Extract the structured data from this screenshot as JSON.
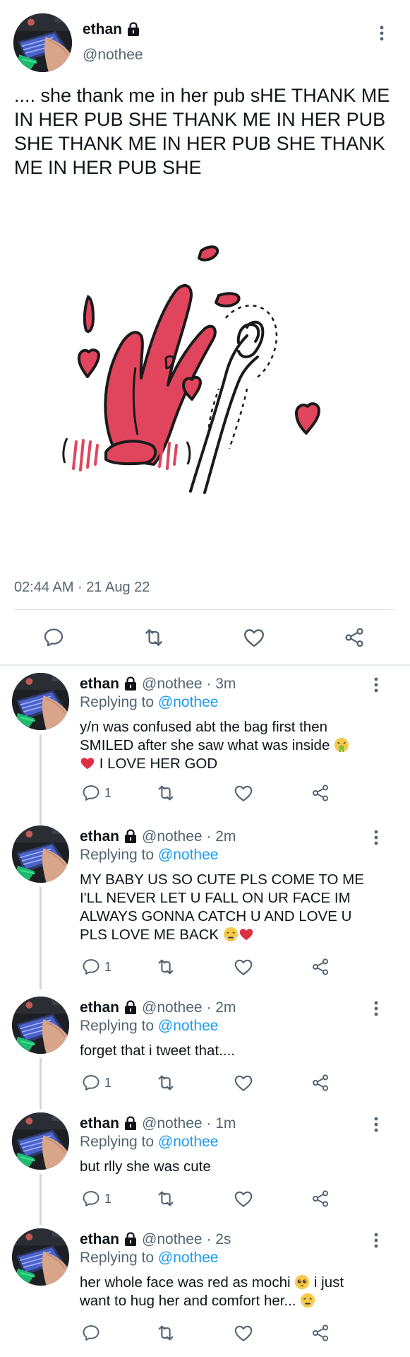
{
  "main_tweet": {
    "name": "ethan",
    "handle": "@nothee",
    "text": ".... she thank me in her pub sHE THANK ME IN HER PUB SHE THANK ME IN HER PUB SHE THANK ME IN HER PUB SHE THANK ME IN HER PUB SHE",
    "timestamp": "02:44 AM · 21 Aug 22",
    "icons": [
      "lock-icon",
      "more-icon",
      "reply-icon",
      "retweet-icon",
      "like-icon",
      "share-icon"
    ],
    "media_description_colors": {
      "heart": "#e0455d",
      "lines": "#111111"
    }
  },
  "replies": [
    {
      "name": "ethan",
      "handle_time": "@nothee · 3m",
      "replying_label": "Replying to",
      "replying_to": "@nothee",
      "line1": "y/n was confused abt the bag first then",
      "line2": "SMILED after she saw what was inside",
      "line3": " I LOVE HER GOD",
      "reply_count": "1"
    },
    {
      "name": "ethan",
      "handle_time": "@nothee · 2m",
      "replying_label": "Replying to",
      "replying_to": "@nothee",
      "line1": "MY BABY US SO CUTE PLS COME TO ME",
      "line2": "I'LL NEVER LET U FALL ON UR FACE IM",
      "line3": "ALWAYS GONNA CATCH U AND LOVE U",
      "line4": "PLS LOVE ME BACK",
      "reply_count": "1"
    },
    {
      "name": "ethan",
      "handle_time": "@nothee · 2m",
      "replying_label": "Replying to",
      "replying_to": "@nothee",
      "line1": "forget that i tweet that....",
      "reply_count": "1"
    },
    {
      "name": "ethan",
      "handle_time": "@nothee · 1m",
      "replying_label": "Replying to",
      "replying_to": "@nothee",
      "line1": "but rlly she was cute",
      "reply_count": "1"
    },
    {
      "name": "ethan",
      "handle_time": "@nothee · 2s",
      "replying_label": "Replying to",
      "replying_to": "@nothee",
      "line1": "her whole face was red as mochi",
      "line1b": " i just",
      "line2": "want to hug her and comfort her...",
      "reply_count": ""
    }
  ],
  "colors": {
    "accent": "#1d9bf0",
    "muted": "#536471",
    "text": "#0f1419",
    "icon": "#536471",
    "heart": "#e0455d"
  }
}
